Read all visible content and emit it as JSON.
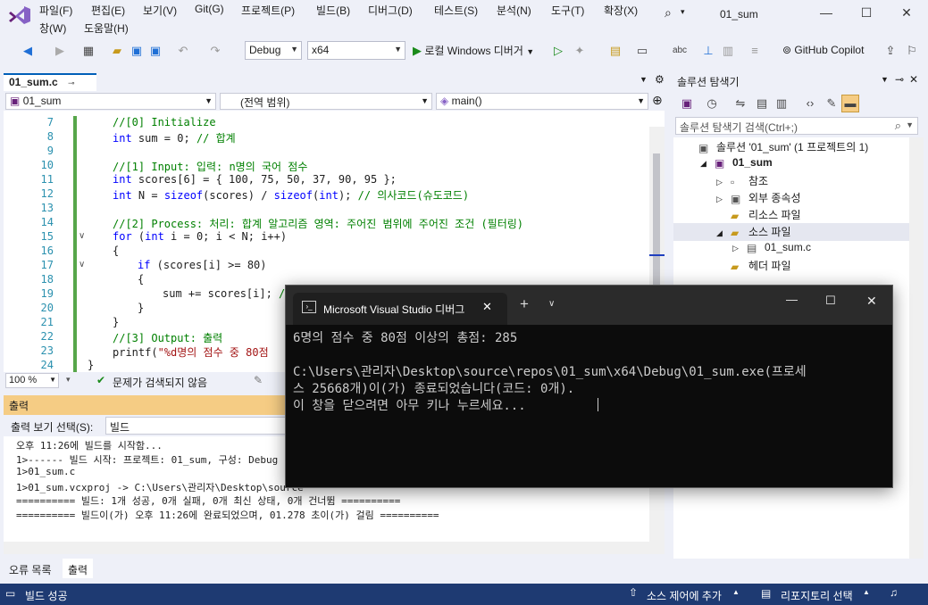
{
  "menu": {
    "row1": [
      "파일(F)",
      "편집(E)",
      "보기(V)",
      "Git(G)",
      "프로젝트(P)",
      "빌드(B)",
      "디버그(D)",
      "테스트(S)",
      "분석(N)",
      "도구(T)",
      "확장(X)"
    ],
    "row2": [
      "창(W)",
      "도움말(H)"
    ],
    "solution_name": "01_sum"
  },
  "toolbar": {
    "config": "Debug",
    "platform": "x64",
    "run_label": "로컬 Windows 디버거",
    "copilot": "GitHub Copilot"
  },
  "editor": {
    "tab_name": "01_sum.c",
    "nav_project": "01_sum",
    "nav_scope": "(전역 범위)",
    "nav_function": "main()",
    "zoom": "100 %",
    "status": "문제가 검색되지 않음",
    "lines": [
      {
        "n": "7",
        "parts": [
          [
            "cm",
            "//[0] Initialize"
          ]
        ],
        "indent": 1
      },
      {
        "n": "8",
        "parts": [
          [
            "kw",
            "int"
          ],
          [
            "",
            " sum = 0; "
          ],
          [
            "cm",
            "// 합계"
          ]
        ],
        "indent": 1
      },
      {
        "n": "9",
        "parts": [
          [
            "",
            ""
          ]
        ],
        "indent": 1
      },
      {
        "n": "10",
        "parts": [
          [
            "cm",
            "//[1] Input: 입력: n명의 국어 점수"
          ]
        ],
        "indent": 1
      },
      {
        "n": "11",
        "parts": [
          [
            "kw",
            "int"
          ],
          [
            "",
            " scores[6] = { 100, 75, 50, 37, 90, 95 };"
          ]
        ],
        "indent": 1
      },
      {
        "n": "12",
        "parts": [
          [
            "kw",
            "int"
          ],
          [
            "",
            " N = "
          ],
          [
            "kw",
            "sizeof"
          ],
          [
            "",
            "(scores) / "
          ],
          [
            "kw",
            "sizeof"
          ],
          [
            "",
            "("
          ],
          [
            "kw",
            "int"
          ],
          [
            "",
            "); "
          ],
          [
            "cm",
            "// 의사코드(슈도코드)"
          ]
        ],
        "indent": 1
      },
      {
        "n": "13",
        "parts": [
          [
            "",
            ""
          ]
        ],
        "indent": 1
      },
      {
        "n": "14",
        "parts": [
          [
            "cm",
            "//[2] Process: 처리: 합계 알고리즘 영역: 주어진 범위에 주어진 조건 (필터링)"
          ]
        ],
        "indent": 1
      },
      {
        "n": "15",
        "parts": [
          [
            "kw",
            "for"
          ],
          [
            "",
            " ("
          ],
          [
            "kw",
            "int"
          ],
          [
            "",
            " i = 0; i < N; i++)"
          ]
        ],
        "indent": 1
      },
      {
        "n": "16",
        "parts": [
          [
            "",
            "{"
          ]
        ],
        "indent": 1
      },
      {
        "n": "17",
        "parts": [
          [
            "kw",
            "if"
          ],
          [
            "",
            " (scores[i] >= 80)"
          ]
        ],
        "indent": 2
      },
      {
        "n": "18",
        "parts": [
          [
            "",
            "{"
          ]
        ],
        "indent": 2
      },
      {
        "n": "19",
        "parts": [
          [
            "",
            "sum += scores[i]; "
          ],
          [
            "cm",
            "//"
          ]
        ],
        "indent": 3
      },
      {
        "n": "20",
        "parts": [
          [
            "",
            "}"
          ]
        ],
        "indent": 2
      },
      {
        "n": "21",
        "parts": [
          [
            "",
            "}"
          ]
        ],
        "indent": 1
      },
      {
        "n": "22",
        "parts": [
          [
            "cm",
            "//[3] Output: 출력"
          ]
        ],
        "indent": 1
      },
      {
        "n": "23",
        "parts": [
          [
            "",
            "printf("
          ],
          [
            "str",
            "\"%d명의 점수 중 80점"
          ]
        ],
        "indent": 1
      },
      {
        "n": "24",
        "parts": [
          [
            "",
            "}"
          ]
        ],
        "indent": 0
      }
    ]
  },
  "output": {
    "title": "출력",
    "source_label": "출력 보기 선택(S):",
    "source_value": "빌드",
    "lines": [
      "오후 11:26에 빌드를 시작함...",
      "1>------ 빌드 시작: 프로젝트: 01_sum, 구성: Debug",
      "1>01_sum.c",
      "1>01_sum.vcxproj -> C:\\Users\\관리자\\Desktop\\source",
      "========== 빌드: 1개 성공, 0개 실패, 0개 최신 상태, 0개 건너뜀 ==========",
      "========== 빌드이(가) 오후 11:26에 완료되었으며, 01.278 초이(가) 걸림 =========="
    ],
    "tab_errors": "오류 목록",
    "tab_output": "출력"
  },
  "solution_explorer": {
    "title": "솔루션 탐색기",
    "search_placeholder": "솔루션 탐색기 검색(Ctrl+;)",
    "tree": [
      {
        "label": "솔루션 '01_sum' (1 프로젝트의 1)",
        "depth": 0,
        "arrow": ""
      },
      {
        "label": "01_sum",
        "depth": 1,
        "arrow": "◢",
        "bold": true
      },
      {
        "label": "참조",
        "depth": 2,
        "arrow": "▷"
      },
      {
        "label": "외부 종속성",
        "depth": 2,
        "arrow": "▷"
      },
      {
        "label": "리소스 파일",
        "depth": 2,
        "arrow": ""
      },
      {
        "label": "소스 파일",
        "depth": 2,
        "arrow": "◢",
        "selected": true
      },
      {
        "label": "01_sum.c",
        "depth": 3,
        "arrow": "▷"
      },
      {
        "label": "헤더 파일",
        "depth": 2,
        "arrow": ""
      }
    ]
  },
  "statusbar": {
    "build": "빌드 성공",
    "source_control": "소스 제어에 추가",
    "repo": "리포지토리 선택"
  },
  "console": {
    "title": "Microsoft Visual Studio 디버그",
    "lines": [
      "6명의 점수 중 80점 이상의 총점: 285",
      "",
      "C:\\Users\\관리자\\Desktop\\source\\repos\\01_sum\\x64\\Debug\\01_sum.exe(프로세",
      "스 25668개)이(가) 종료되었습니다(코드: 0개).",
      "이 창을 닫으려면 아무 키나 누르세요..."
    ]
  }
}
